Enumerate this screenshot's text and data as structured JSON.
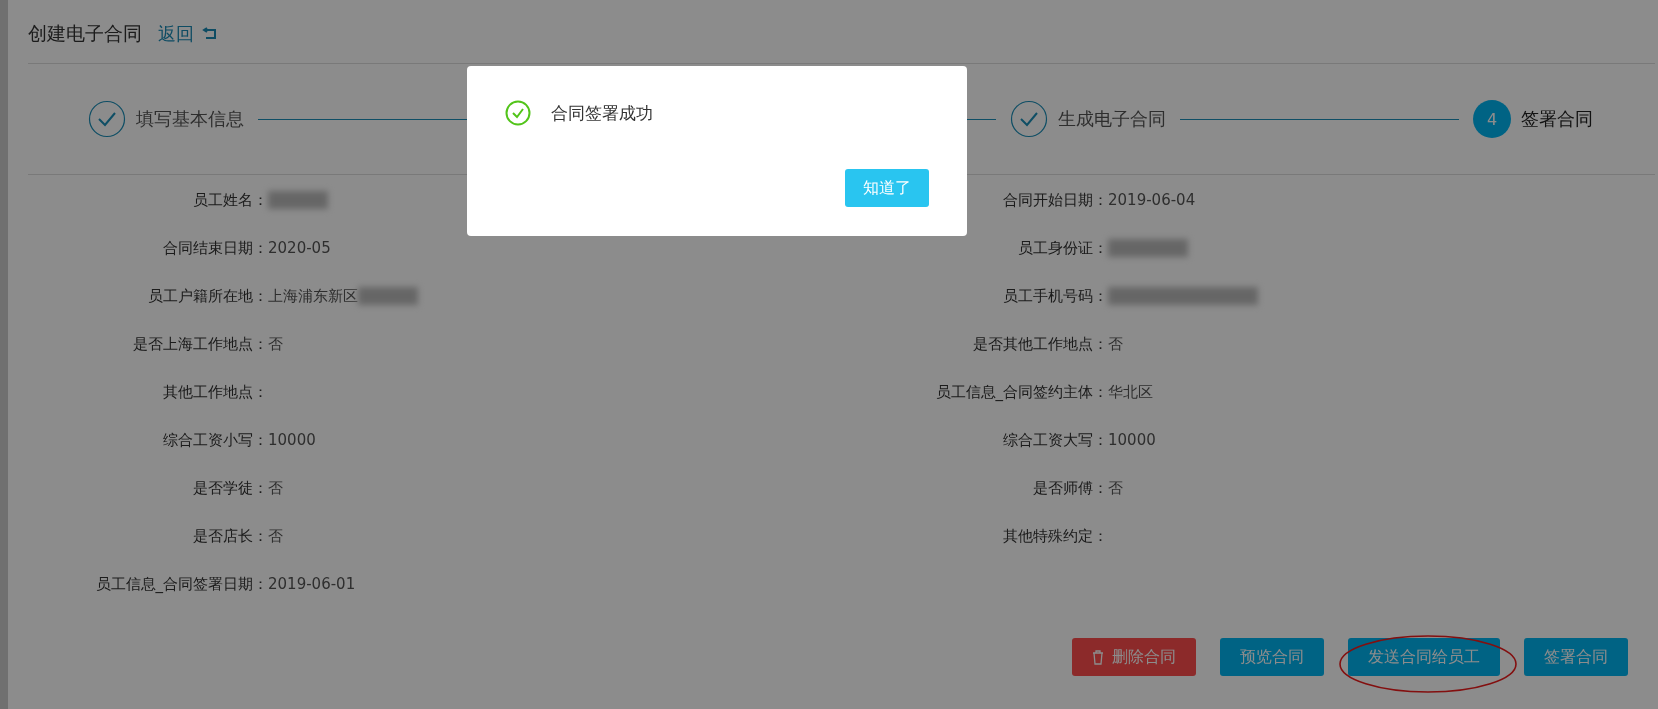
{
  "header": {
    "title": "创建电子合同",
    "back_link": "返回"
  },
  "steps": [
    {
      "label": "填写基本信息",
      "completed": true
    },
    {
      "label": "生成电子合同",
      "completed": true
    },
    {
      "label": "签署合同",
      "completed": false,
      "number": "4"
    }
  ],
  "fields": [
    {
      "label": "员工姓名：",
      "redacted": true
    },
    {
      "label": "合同开始日期：",
      "value": "2019-06-04"
    },
    {
      "label": "合同结束日期：",
      "value": "2020-05"
    },
    {
      "label": "员工身份证：",
      "redacted": true
    },
    {
      "label": "员工户籍所在地：",
      "value": "上海浦东新区",
      "redacted": true
    },
    {
      "label": "员工手机号码：",
      "redacted": true
    },
    {
      "label": "是否上海工作地点：",
      "value": "否"
    },
    {
      "label": "是否其他工作地点：",
      "value": "否"
    },
    {
      "label": "其他工作地点："
    },
    {
      "label": "员工信息_合同签约主体：",
      "value": "华北区"
    },
    {
      "label": "综合工资小写：",
      "value": "10000"
    },
    {
      "label": "综合工资大写：",
      "value": "10000"
    },
    {
      "label": "是否学徒：",
      "value": "否"
    },
    {
      "label": "是否师傅：",
      "value": "否"
    },
    {
      "label": "是否店长：",
      "value": "否"
    },
    {
      "label": "其他特殊约定："
    },
    {
      "label": "员工信息_合同签署日期：",
      "value": "2019-06-01"
    }
  ],
  "actions": [
    {
      "label": "删除合同",
      "kind": "danger",
      "circled": false
    },
    {
      "label": "预览合同",
      "kind": "primary",
      "circled": false
    },
    {
      "label": "发送合同给员工",
      "kind": "primary",
      "circled": true
    },
    {
      "label": "签署合同",
      "kind": "primary",
      "circled": false
    }
  ],
  "dialog": {
    "message": "合同签署成功",
    "button": "知道了"
  }
}
